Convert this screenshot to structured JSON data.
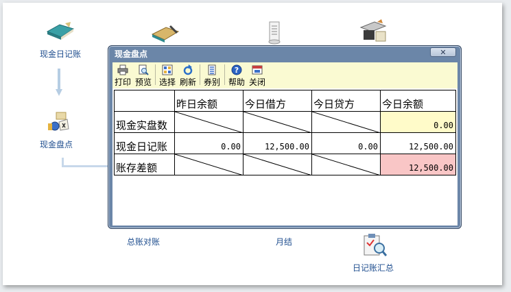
{
  "desktop": {
    "icons": [
      {
        "label": "现金日记账"
      },
      {
        "label": "现金盘点"
      },
      {
        "label": "总账对账"
      },
      {
        "label": "月结"
      },
      {
        "label": "日记账汇总"
      }
    ]
  },
  "dialog": {
    "title": "现金盘点",
    "close_label": "✕",
    "toolbar": [
      {
        "label": "打印",
        "icon": "printer-icon"
      },
      {
        "label": "预览",
        "icon": "preview-icon"
      },
      {
        "label": "选择",
        "icon": "select-icon"
      },
      {
        "label": "刷新",
        "icon": "refresh-icon"
      },
      {
        "label": "券别",
        "icon": "denomination-icon"
      },
      {
        "label": "帮助",
        "icon": "help-icon"
      },
      {
        "label": "关闭",
        "icon": "close-window-icon"
      }
    ],
    "table": {
      "headers": [
        "",
        "昨日余额",
        "今日借方",
        "今日贷方",
        "今日余额"
      ],
      "rows": [
        {
          "label": "现金实盘数",
          "cells": [
            "",
            "",
            "",
            "0.00"
          ]
        },
        {
          "label": "现金日记账",
          "cells": [
            "0.00",
            "12,500.00",
            "0.00",
            "12,500.00"
          ]
        },
        {
          "label": "账存差额",
          "cells": [
            "",
            "",
            "",
            "12,500.00"
          ]
        }
      ]
    },
    "colors": {
      "highlight_yellow": "#fffbc9",
      "highlight_pink": "#f9c6c6",
      "titlebar": "#6b86a8"
    }
  }
}
